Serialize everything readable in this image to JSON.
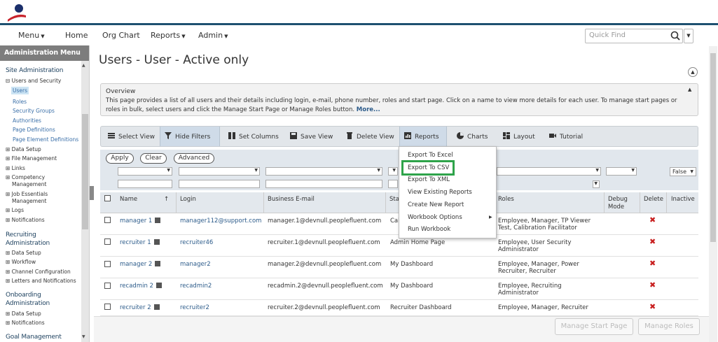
{
  "nav": {
    "menu": "Menu",
    "home": "Home",
    "org_chart": "Org Chart",
    "reports": "Reports",
    "admin": "Admin",
    "quick_find_placeholder": "Quick Find"
  },
  "sidebar": {
    "header": "Administration Menu",
    "site_admin": "Site Administration",
    "users_and_security": "Users and Security",
    "users": "Users",
    "roles": "Roles",
    "security_groups": "Security Groups",
    "authorities": "Authorities",
    "page_definitions": "Page Definitions",
    "page_element_definitions": "Page Element Definitions",
    "data_setup": "Data Setup",
    "file_management": "File Management",
    "links": "Links",
    "competency_1": "Competency",
    "competency_2": "Management",
    "job_essentials_1": "Job Essentials",
    "job_essentials_2": "Management",
    "logs": "Logs",
    "notifications": "Notifications",
    "recruiting_1": "Recruiting",
    "recruiting_2": "Administration",
    "r_data_setup": "Data Setup",
    "r_workflow": "Workflow",
    "r_channel": "Channel Configuration",
    "r_letters": "Letters and Notifications",
    "onboarding_1": "Onboarding",
    "onboarding_2": "Administration",
    "o_data_setup": "Data Setup",
    "o_notifications": "Notifications",
    "goal_mgmt": "Goal Management"
  },
  "page": {
    "title": "Users - User - Active only",
    "overview_title": "Overview",
    "overview_text": "This page provides a list of all users and their details including login, e-mail, phone number, roles and start page. Click on a name to view more details for each user. To manage start pages or roles in bulk, select users and click the Manage Start Page or Manage Roles button.",
    "overview_more": "More..."
  },
  "toolbar": {
    "select_view": "Select View",
    "hide_filters": "Hide Filters",
    "set_columns": "Set Columns",
    "save_view": "Save View",
    "delete_view": "Delete View",
    "reports": "Reports",
    "charts": "Charts",
    "layout": "Layout",
    "tutorial": "Tutorial"
  },
  "filters": {
    "apply": "Apply",
    "clear": "Clear",
    "advanced": "Advanced",
    "inactive_value": "False"
  },
  "table": {
    "headers": {
      "name": "Name",
      "login": "Login",
      "email": "Business E-mail",
      "start": "Sta",
      "roles": "Roles",
      "debug1": "Debug",
      "debug2": "Mode",
      "delete": "Delete",
      "inactive": "Inactive",
      "sort_arrow": "↑"
    },
    "rows": [
      {
        "name": "manager 1",
        "login": "manager112@support.com",
        "email": "manager.1@devnull.peoplefluent.com",
        "start": "Cal",
        "roles": "Employee, Manager, TP Viewer Test, Calibration Facilitator"
      },
      {
        "name": "recruiter 1",
        "login": "recruiter46",
        "email": "recruiter.1@devnull.peoplefluent.com",
        "start": "Admin Home Page",
        "roles": "Employee, User Security Administrator"
      },
      {
        "name": "manager 2",
        "login": "manager2",
        "email": "manager.2@devnull.peoplefluent.com",
        "start": "My Dashboard",
        "roles": "Employee, Manager, Power Recruiter, Recruiter"
      },
      {
        "name": "recadmin 2",
        "login": "recadmin2",
        "email": "recadmin.2@devnull.peoplefluent.com",
        "start": "My Dashboard",
        "roles": "Employee, Recruiting Administrator"
      },
      {
        "name": "recruiter 2",
        "login": "recruiter2",
        "email": "recruiter.2@devnull.peoplefluent.com",
        "start": "Recruiter Dashboard",
        "roles": "Employee, Manager, Recruiter"
      }
    ]
  },
  "reports_menu": {
    "items": [
      "Export To Excel",
      "Export To CSV",
      "Export To XML",
      "View Existing Reports",
      "Create New Report",
      "Workbook Options",
      "Run Workbook"
    ]
  },
  "footer": {
    "manage_start_page": "Manage Start Page",
    "manage_roles": "Manage Roles"
  },
  "icons": {
    "delete": "x-mark-icon",
    "filter": "filter-icon",
    "card": "id-card-icon"
  },
  "colors": {
    "brand_navy": "#1e5070",
    "delete_red": "#c81e1e",
    "highlight_green": "#2ea34a"
  }
}
